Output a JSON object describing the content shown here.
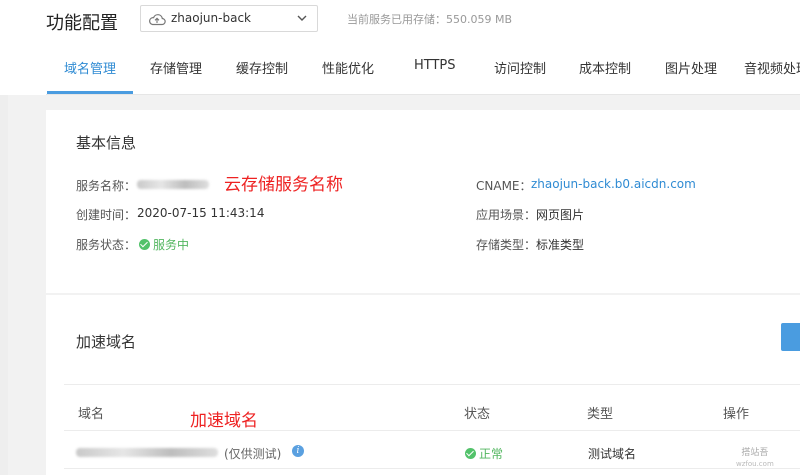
{
  "header": {
    "page_title": "功能配置",
    "bucket_name": "zhaojun-back",
    "usage_text": "当前服务已用存储：550.059 MB"
  },
  "tabs": [
    {
      "label": "域名管理",
      "active": true
    },
    {
      "label": "存储管理"
    },
    {
      "label": "缓存控制"
    },
    {
      "label": "性能优化"
    },
    {
      "label": "HTTPS"
    },
    {
      "label": "访问控制"
    },
    {
      "label": "成本控制"
    },
    {
      "label": "图片处理"
    },
    {
      "label": "音视频处理"
    }
  ],
  "basic_info": {
    "title": "基本信息",
    "service_name_label": "服务名称：",
    "service_name_annotation": "云存储服务名称",
    "created_label": "创建时间：",
    "created_value": "2020-07-15 11:43:14",
    "status_label": "服务状态：",
    "status_value": "服务中",
    "cname_label": "CNAME：",
    "cname_value": "zhaojun-back.b0.aicdn.com",
    "scene_label": "应用场景：",
    "scene_value": "网页图片",
    "storage_type_label": "存储类型：",
    "storage_type_value": "标准类型"
  },
  "accel_domain": {
    "title": "加速域名",
    "annotation": "加速域名",
    "columns": [
      "域名",
      "状态",
      "类型",
      "操作"
    ],
    "row": {
      "suffix": "(仅供测试)",
      "status": "正常",
      "type": "测试域名"
    }
  },
  "watermark": {
    "line1": "搭站吾",
    "line2": "wzfou.com"
  },
  "colors": {
    "accent": "#2f8bd3",
    "success": "#52c26a",
    "annotation": "#ee2222"
  }
}
